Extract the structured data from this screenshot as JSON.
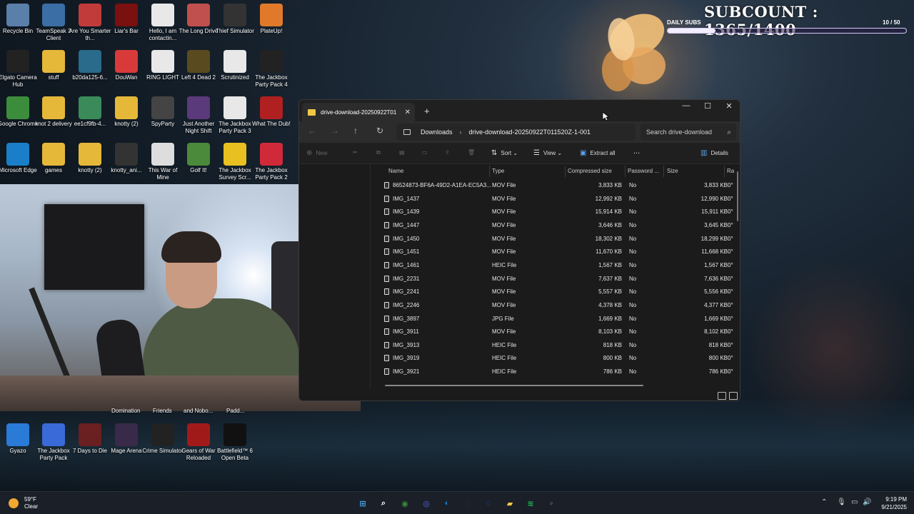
{
  "overlay": {
    "subcount": "SUBCOUNT : 1365/1400",
    "daily_label": "DAILY SUBS",
    "daily_count": "10 / 50",
    "daily_progress": 0.2
  },
  "desktop_icons": [
    {
      "label": "Recycle Bin",
      "icon": "recycle-bin-icon",
      "color": "#5a7fa8"
    },
    {
      "label": "TeamSpeak 3 Client",
      "icon": "teamspeak-icon",
      "color": "#3a6ea5"
    },
    {
      "label": "Are You Smarter th...",
      "icon": "game-icon",
      "color": "#c23b3b"
    },
    {
      "label": "Liar's Bar",
      "icon": "liars-bar-icon",
      "color": "#7a1010"
    },
    {
      "label": "Hello, I am contactin...",
      "icon": "document-icon",
      "color": "#e8e8e8"
    },
    {
      "label": "The Long Drive",
      "icon": "car-icon",
      "color": "#c0504d"
    },
    {
      "label": "Thief Simulator",
      "icon": "thief-icon",
      "color": "#333333"
    },
    {
      "label": "PlateUp!",
      "icon": "plateup-icon",
      "color": "#e07a2a"
    },
    {
      "label": "Elgato Camera Hub",
      "icon": "camera-icon",
      "color": "#222222"
    },
    {
      "label": "stuff",
      "icon": "folder-icon",
      "color": "#e5b83a"
    },
    {
      "label": "b20da125-6...",
      "icon": "app-icon",
      "color": "#2a6a8a"
    },
    {
      "label": "DouWan",
      "icon": "douwan-icon",
      "color": "#d83a3a"
    },
    {
      "label": "RING LIGHT",
      "icon": "document-icon",
      "color": "#e8e8e8"
    },
    {
      "label": "Left 4 Dead 2",
      "icon": "l4d2-icon",
      "color": "#5a4a20"
    },
    {
      "label": "Scrutinized",
      "icon": "document-icon",
      "color": "#e8e8e8"
    },
    {
      "label": "The Jackbox Party Pack 4",
      "icon": "jackbox-icon",
      "color": "#222222"
    },
    {
      "label": "Google Chrome",
      "icon": "chrome-icon",
      "color": "#3b8d3b"
    },
    {
      "label": "knot 2 delivery",
      "icon": "folder-icon",
      "color": "#e5b83a"
    },
    {
      "label": "ee1cf9fb-4...",
      "icon": "app-icon",
      "color": "#3a8a5a"
    },
    {
      "label": "knotty (2)",
      "icon": "folder-icon",
      "color": "#e5b83a"
    },
    {
      "label": "SpyParty",
      "icon": "spyparty-icon",
      "color": "#444444"
    },
    {
      "label": "Just Another Night Shift",
      "icon": "night-shift-icon",
      "color": "#5a3a7a"
    },
    {
      "label": "The Jackbox Party Pack 3",
      "icon": "jackbox-icon",
      "color": "#e8e8e8"
    },
    {
      "label": "What The Dub!",
      "icon": "wtd-icon",
      "color": "#b02020"
    },
    {
      "label": "Microsoft Edge",
      "icon": "edge-icon",
      "color": "#1a7fc8"
    },
    {
      "label": "games",
      "icon": "folder-icon",
      "color": "#e5b83a"
    },
    {
      "label": "knotty (2)",
      "icon": "folder-icon",
      "color": "#e5b83a"
    },
    {
      "label": "knotty_ani...",
      "icon": "video-icon",
      "color": "#333333"
    },
    {
      "label": "This War of Mine",
      "icon": "twom-icon",
      "color": "#ddd"
    },
    {
      "label": "Golf It!",
      "icon": "golf-icon",
      "color": "#4a8a3a"
    },
    {
      "label": "The Jackbox Survey Scr...",
      "icon": "jackbox-icon",
      "color": "#e8c020"
    },
    {
      "label": "The Jackbox Party Pack 2",
      "icon": "jackbox-icon",
      "color": "#d02a3a"
    },
    {
      "label": "Gyazo",
      "icon": "gyazo-icon",
      "color": "#2a7ad8"
    },
    {
      "label": "The Jackbox Party Pack",
      "icon": "jackbox-icon",
      "color": "#3a6ad8"
    },
    {
      "label": "7 Days to Die",
      "icon": "7dtd-icon",
      "color": "#6a2020"
    },
    {
      "label": "Mage Arena",
      "icon": "mage-arena-icon",
      "color": "#3a2a4a"
    },
    {
      "label": "Crime Simulator",
      "icon": "crime-icon",
      "color": "#222222"
    },
    {
      "label": "Gears of War Reloaded",
      "icon": "gears-icon",
      "color": "#a01a1a"
    },
    {
      "label": "Battlefield™ 6 Open Beta",
      "icon": "battlefield-icon",
      "color": "#111111"
    }
  ],
  "hidden_labels": [
    "Domination",
    "Friends",
    "and Nobo...",
    "Padd..."
  ],
  "explorer": {
    "tab_title": "drive-download-20250922T01",
    "breadcrumb": [
      "Downloads",
      "drive-download-20250922T011520Z-1-001"
    ],
    "search_placeholder": "Search drive-download",
    "toolbar": {
      "new": "New",
      "sort": "Sort",
      "view": "View",
      "extract": "Extract all",
      "more": "...",
      "details": "Details"
    },
    "columns": [
      "Name",
      "Type",
      "Compressed size",
      "Password ...",
      "Size",
      "Ra"
    ],
    "files": [
      {
        "name": "86524873-BF6A-49D2-A1EA-EC5A3...",
        "type": "MOV File",
        "compressed": "3,833 KB",
        "password": "No",
        "size": "3,833 KB",
        "ratio": "0°"
      },
      {
        "name": "IMG_1437",
        "type": "MOV File",
        "compressed": "12,992 KB",
        "password": "No",
        "size": "12,990 KB",
        "ratio": "0°"
      },
      {
        "name": "IMG_1439",
        "type": "MOV File",
        "compressed": "15,914 KB",
        "password": "No",
        "size": "15,911 KB",
        "ratio": "0°"
      },
      {
        "name": "IMG_1447",
        "type": "MOV File",
        "compressed": "3,646 KB",
        "password": "No",
        "size": "3,645 KB",
        "ratio": "0°"
      },
      {
        "name": "IMG_1450",
        "type": "MOV File",
        "compressed": "18,302 KB",
        "password": "No",
        "size": "18,299 KB",
        "ratio": "0°"
      },
      {
        "name": "IMG_1451",
        "type": "MOV File",
        "compressed": "11,670 KB",
        "password": "No",
        "size": "11,668 KB",
        "ratio": "0°"
      },
      {
        "name": "IMG_1461",
        "type": "HEIC File",
        "compressed": "1,567 KB",
        "password": "No",
        "size": "1,567 KB",
        "ratio": "0°"
      },
      {
        "name": "IMG_2231",
        "type": "MOV File",
        "compressed": "7,637 KB",
        "password": "No",
        "size": "7,636 KB",
        "ratio": "0°"
      },
      {
        "name": "IMG_2241",
        "type": "MOV File",
        "compressed": "5,557 KB",
        "password": "No",
        "size": "5,556 KB",
        "ratio": "0°"
      },
      {
        "name": "IMG_2246",
        "type": "MOV File",
        "compressed": "4,378 KB",
        "password": "No",
        "size": "4,377 KB",
        "ratio": "0°"
      },
      {
        "name": "IMG_3897",
        "type": "JPG File",
        "compressed": "1,669 KB",
        "password": "No",
        "size": "1,669 KB",
        "ratio": "0°"
      },
      {
        "name": "IMG_3911",
        "type": "MOV File",
        "compressed": "8,103 KB",
        "password": "No",
        "size": "8,102 KB",
        "ratio": "0°"
      },
      {
        "name": "IMG_3913",
        "type": "HEIC File",
        "compressed": "818 KB",
        "password": "No",
        "size": "818 KB",
        "ratio": "0°"
      },
      {
        "name": "IMG_3919",
        "type": "HEIC File",
        "compressed": "800 KB",
        "password": "No",
        "size": "800 KB",
        "ratio": "0°"
      },
      {
        "name": "IMG_3921",
        "type": "HEIC File",
        "compressed": "786 KB",
        "password": "No",
        "size": "786 KB",
        "ratio": "0°"
      }
    ]
  },
  "taskbar": {
    "weather_temp": "59°F",
    "weather_desc": "Clear",
    "time": "9:19 PM",
    "date": "9/21/2025",
    "apps": [
      {
        "icon": "start-icon",
        "color": "#4aa8f0"
      },
      {
        "icon": "search-icon",
        "color": "#ffffff"
      },
      {
        "icon": "chrome-icon",
        "color": "#3b8d3b"
      },
      {
        "icon": "discord-icon",
        "color": "#5865f2"
      },
      {
        "icon": "edge-icon",
        "color": "#1a7fc8"
      },
      {
        "icon": "steam-icon",
        "color": "#1b2838"
      },
      {
        "icon": "browser-icon",
        "color": "#2a6ad8"
      },
      {
        "icon": "file-explorer-icon",
        "color": "#f3c744"
      },
      {
        "icon": "spotify-icon",
        "color": "#1db954"
      },
      {
        "icon": "obs-icon",
        "color": "#444444"
      }
    ]
  }
}
